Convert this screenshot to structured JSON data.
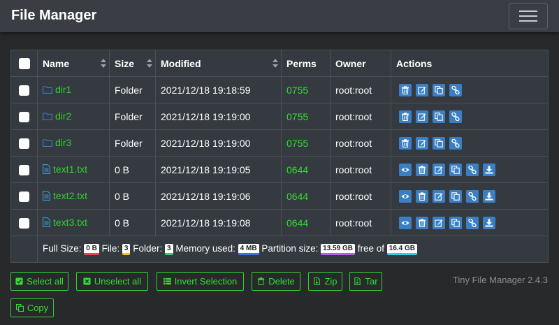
{
  "navbar": {
    "brand": "File Manager"
  },
  "table": {
    "headers": {
      "name": "Name",
      "size": "Size",
      "modified": "Modified",
      "perms": "Perms",
      "owner": "Owner",
      "actions": "Actions"
    },
    "rows": [
      {
        "type": "folder",
        "name": "dir1",
        "size": "Folder",
        "modified": "2021/12/18 19:18:59",
        "perms": "0755",
        "owner": "root:root"
      },
      {
        "type": "folder",
        "name": "dir2",
        "size": "Folder",
        "modified": "2021/12/18 19:19:00",
        "perms": "0755",
        "owner": "root:root"
      },
      {
        "type": "folder",
        "name": "dir3",
        "size": "Folder",
        "modified": "2021/12/18 19:19:00",
        "perms": "0755",
        "owner": "root:root"
      },
      {
        "type": "file",
        "name": "text1.txt",
        "size": "0 B",
        "modified": "2021/12/18 19:19:05",
        "perms": "0644",
        "owner": "root:root"
      },
      {
        "type": "file",
        "name": "text2.txt",
        "size": "0 B",
        "modified": "2021/12/18 19:19:06",
        "perms": "0644",
        "owner": "root:root"
      },
      {
        "type": "file",
        "name": "text3.txt",
        "size": "0 B",
        "modified": "2021/12/18 19:19:08",
        "perms": "0644",
        "owner": "root:root"
      }
    ],
    "folder_actions": [
      "trash-icon",
      "edit-icon",
      "copy-icon",
      "link-icon"
    ],
    "file_actions": [
      "eye-icon",
      "trash-icon",
      "edit-icon",
      "copy-icon",
      "link-icon",
      "download-icon"
    ]
  },
  "summary": {
    "full_size_label": "Full Size:",
    "full_size": "0 B",
    "file_label": "File:",
    "file_count": "3",
    "folder_label": "Folder:",
    "folder_count": "3",
    "memory_label": "Memory used:",
    "memory": "4 MB",
    "partition_label": "Partition size:",
    "partition": "13.59 GB",
    "free_label": "free of",
    "free": "16.4 GB"
  },
  "buttons": {
    "select_all": "Select all",
    "unselect_all": "Unselect all",
    "invert": "Invert Selection",
    "delete": "Delete",
    "zip": "Zip",
    "tar": "Tar",
    "copy": "Copy"
  },
  "version": "Tiny File Manager 2.4.3",
  "colors": {
    "accent_green": "#30e030",
    "action_blue": "#3a7fc4",
    "navbar": "#3a3e44",
    "table_bg": "#343a40"
  }
}
